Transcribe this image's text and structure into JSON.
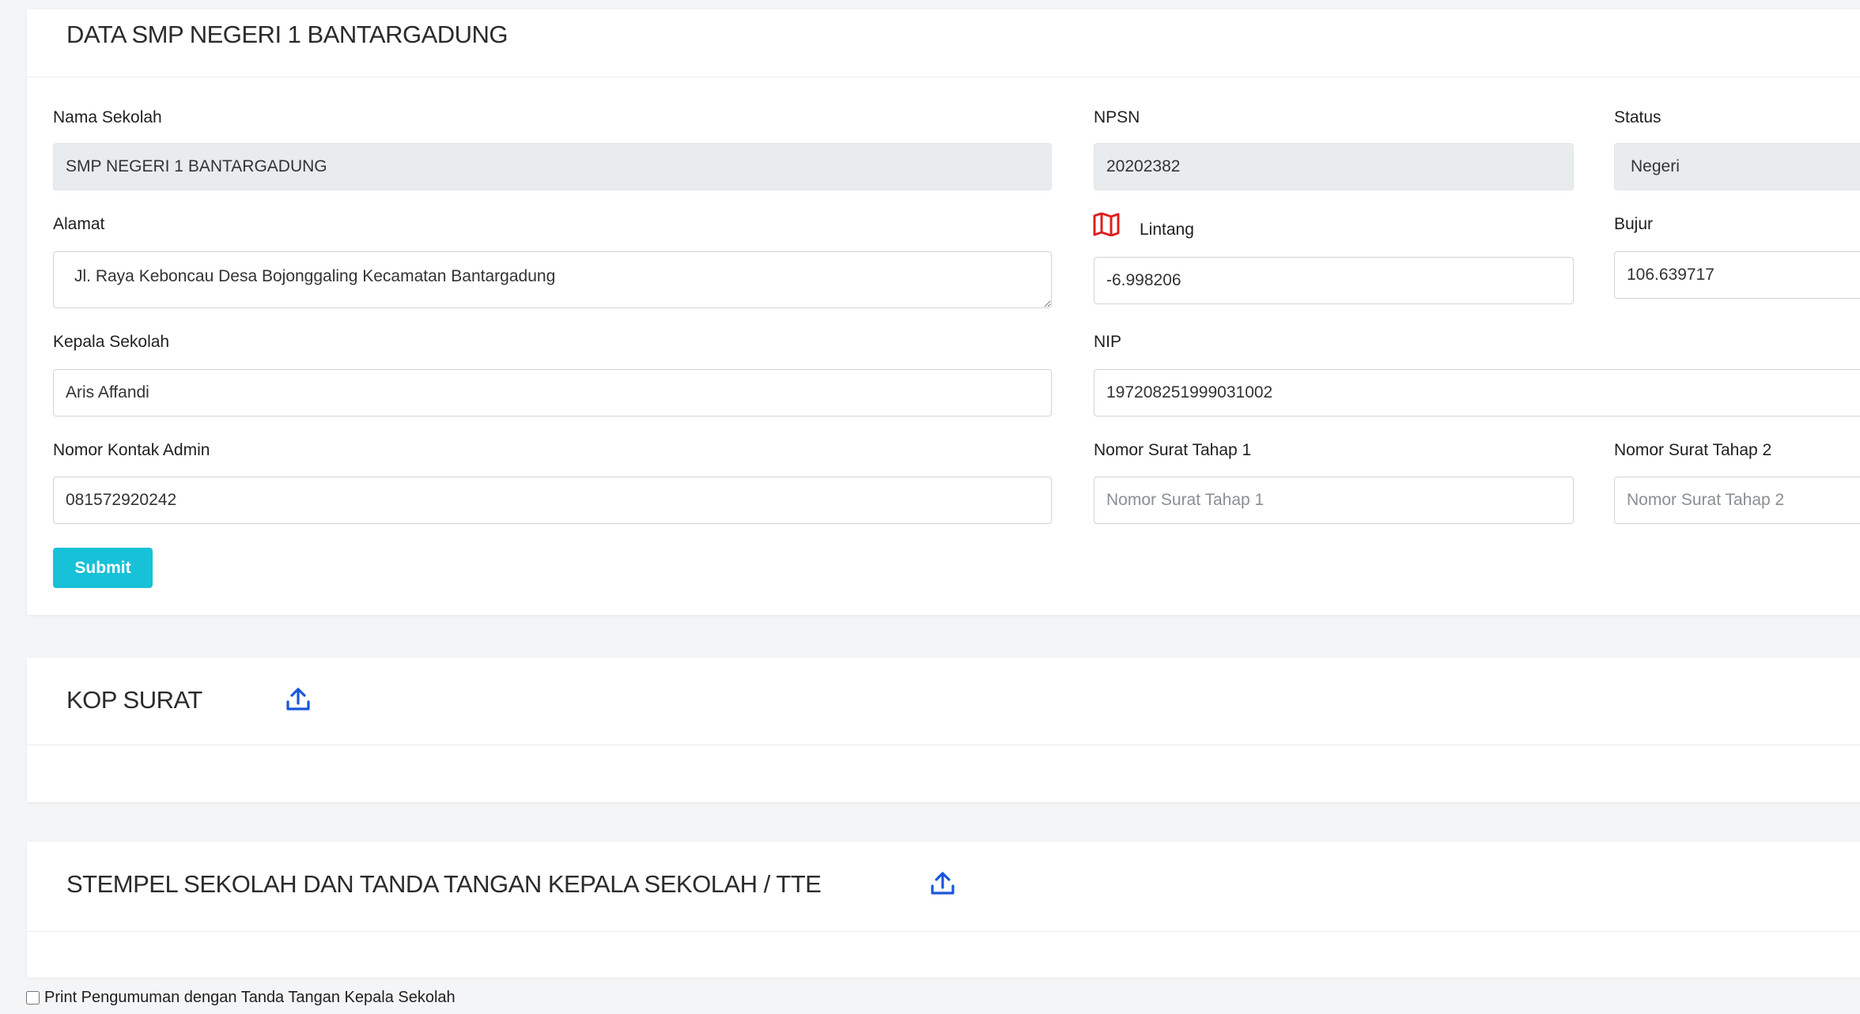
{
  "school_card": {
    "title": "DATA SMP NEGERI 1 BANTARGADUNG",
    "nama_sekolah": {
      "label": "Nama Sekolah",
      "value": "SMP NEGERI 1 BANTARGADUNG"
    },
    "npsn": {
      "label": "NPSN",
      "value": "20202382"
    },
    "status": {
      "label": "Status",
      "value": "Negeri"
    },
    "alamat": {
      "label": "Alamat",
      "value": "Jl. Raya Keboncau Desa Bojonggaling Kecamatan Bantargadung"
    },
    "lintang": {
      "label": "Lintang",
      "value": "-6.998206"
    },
    "bujur": {
      "label": "Bujur",
      "value": "106.639717"
    },
    "kepala_sekolah": {
      "label": "Kepala Sekolah",
      "value": "Aris Affandi"
    },
    "nip": {
      "label": "NIP",
      "value": "197208251999031002"
    },
    "nomor_kontak_admin": {
      "label": "Nomor Kontak Admin",
      "value": "081572920242"
    },
    "nomor_surat_tahap_1": {
      "label": "Nomor Surat Tahap 1",
      "value": "",
      "placeholder": "Nomor Surat Tahap 1"
    },
    "nomor_surat_tahap_2": {
      "label": "Nomor Surat Tahap 2",
      "value": "",
      "placeholder": "Nomor Surat Tahap 2"
    },
    "submit_label": "Submit"
  },
  "kop_card": {
    "title": "KOP SURAT"
  },
  "stempel_card": {
    "title": "STEMPEL SEKOLAH DAN TANDA TANGAN KEPALA SEKOLAH / TTE"
  },
  "print_option": {
    "label": "Print Pengumuman dengan Tanda Tangan Kepala Sekolah",
    "checked": false
  },
  "colors": {
    "accent": "#17c1d8",
    "map_icon": "#e02020",
    "upload_icon": "#1a56db"
  },
  "icons": {
    "map": "map-icon",
    "upload": "upload-icon"
  }
}
